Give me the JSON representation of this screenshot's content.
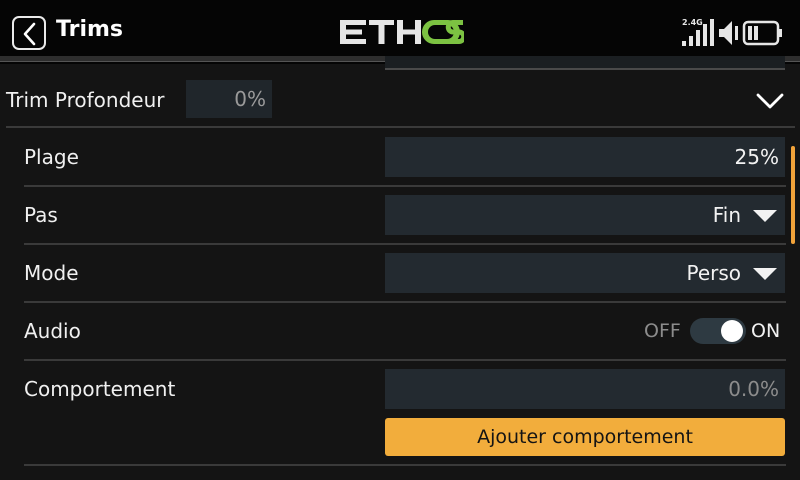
{
  "header": {
    "title": "Trims",
    "logo_text": "ETHOS",
    "logo_color": "#7cc242",
    "signal_band": "2.4G",
    "back_icon": "chevron-left-icon",
    "signal_icon": "signal-bars-icon",
    "volume_icon": "speaker-icon",
    "battery_icon": "battery-icon"
  },
  "section": {
    "label": "Trim Profondeur",
    "value": "0%"
  },
  "rows": {
    "range": {
      "label": "Plage",
      "value": "25%"
    },
    "step": {
      "label": "Pas",
      "value": "Fin"
    },
    "mode": {
      "label": "Mode",
      "value": "Perso"
    },
    "audio": {
      "label": "Audio",
      "off_label": "OFF",
      "on_label": "ON",
      "state": "on"
    },
    "behavior": {
      "label": "Comportement",
      "value": "0.0%",
      "add_label": "Ajouter comportement"
    }
  },
  "colors": {
    "accent": "#f2ad3c",
    "field_bg": "#232a30",
    "background": "#141414"
  }
}
